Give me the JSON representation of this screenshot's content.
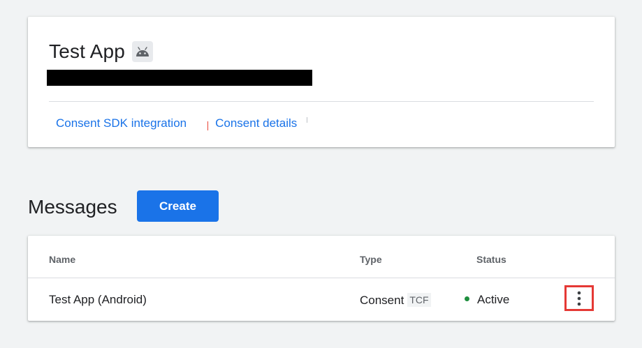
{
  "app": {
    "title": "Test App",
    "platform_icon": "android-icon",
    "links": [
      {
        "label": "Consent SDK integration"
      },
      {
        "label": "Consent details"
      }
    ]
  },
  "messages": {
    "section_title": "Messages",
    "create_label": "Create",
    "columns": [
      "Name",
      "Type",
      "Status"
    ],
    "rows": [
      {
        "name": "Test App (Android)",
        "type": "Consent",
        "type_badge": "TCF",
        "status": "Active",
        "status_color": "#1e8e3e"
      }
    ]
  },
  "colors": {
    "accent": "#1a73e8",
    "highlight": "#e53935",
    "background": "#f1f3f4"
  }
}
